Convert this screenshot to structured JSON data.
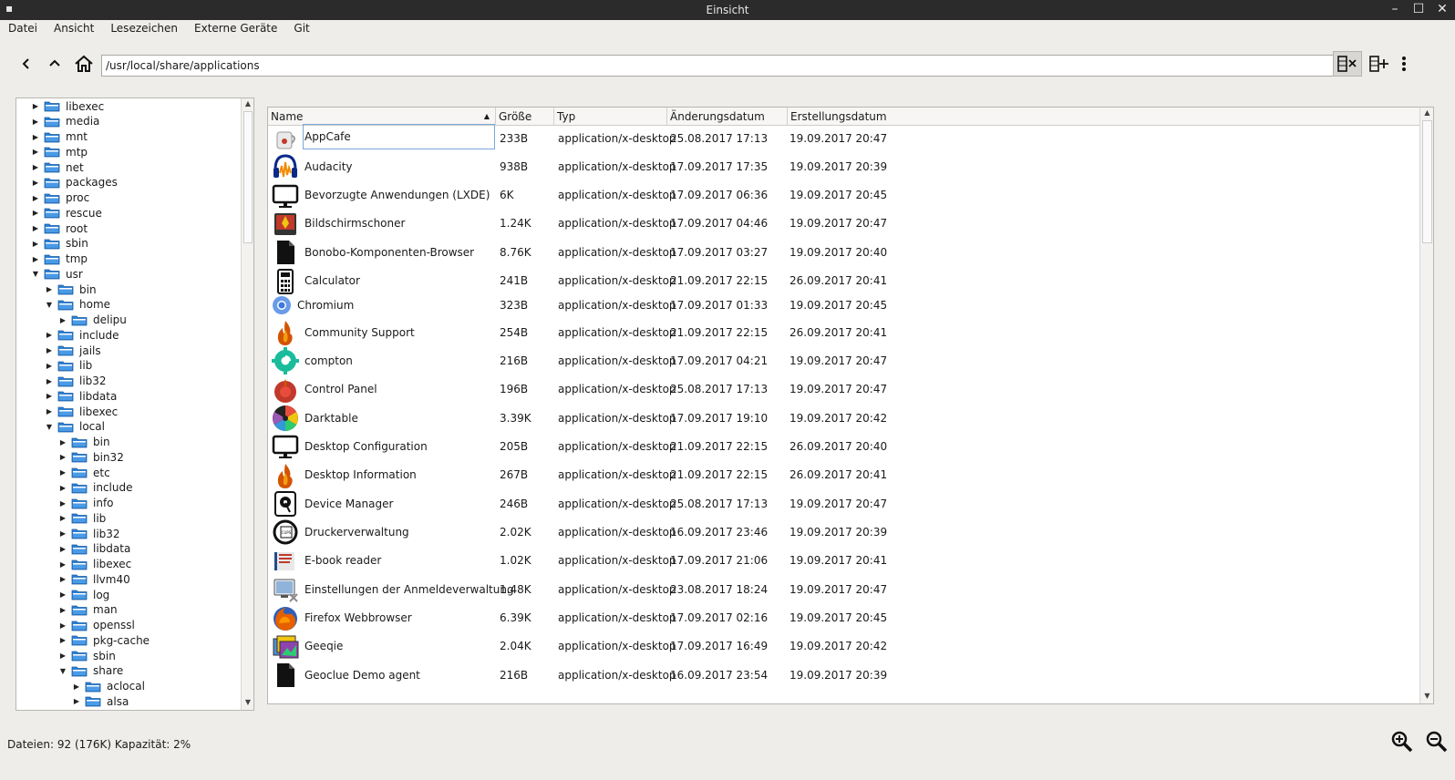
{
  "window": {
    "title": "Einsicht"
  },
  "menu": [
    "Datei",
    "Ansicht",
    "Lesezeichen",
    "Externe Geräte",
    "Git"
  ],
  "toolbar": {
    "path": "/usr/local/share/applications",
    "icons": [
      "back-icon",
      "up-icon",
      "home-icon",
      "close-panel-icon",
      "add-panel-icon",
      "more-options-icon"
    ]
  },
  "tree": [
    {
      "label": "libexec",
      "depth": 0,
      "state": "collapsed"
    },
    {
      "label": "media",
      "depth": 0,
      "state": "collapsed"
    },
    {
      "label": "mnt",
      "depth": 0,
      "state": "collapsed"
    },
    {
      "label": "mtp",
      "depth": 0,
      "state": "collapsed"
    },
    {
      "label": "net",
      "depth": 0,
      "state": "collapsed"
    },
    {
      "label": "packages",
      "depth": 0,
      "state": "collapsed"
    },
    {
      "label": "proc",
      "depth": 0,
      "state": "collapsed"
    },
    {
      "label": "rescue",
      "depth": 0,
      "state": "collapsed"
    },
    {
      "label": "root",
      "depth": 0,
      "state": "collapsed"
    },
    {
      "label": "sbin",
      "depth": 0,
      "state": "collapsed"
    },
    {
      "label": "tmp",
      "depth": 0,
      "state": "collapsed"
    },
    {
      "label": "usr",
      "depth": 0,
      "state": "expanded"
    },
    {
      "label": "bin",
      "depth": 1,
      "state": "collapsed"
    },
    {
      "label": "home",
      "depth": 1,
      "state": "expanded"
    },
    {
      "label": "delipu",
      "depth": 2,
      "state": "collapsed"
    },
    {
      "label": "include",
      "depth": 1,
      "state": "collapsed"
    },
    {
      "label": "jails",
      "depth": 1,
      "state": "collapsed"
    },
    {
      "label": "lib",
      "depth": 1,
      "state": "collapsed"
    },
    {
      "label": "lib32",
      "depth": 1,
      "state": "collapsed"
    },
    {
      "label": "libdata",
      "depth": 1,
      "state": "collapsed"
    },
    {
      "label": "libexec",
      "depth": 1,
      "state": "collapsed"
    },
    {
      "label": "local",
      "depth": 1,
      "state": "expanded"
    },
    {
      "label": "bin",
      "depth": 2,
      "state": "collapsed"
    },
    {
      "label": "bin32",
      "depth": 2,
      "state": "collapsed"
    },
    {
      "label": "etc",
      "depth": 2,
      "state": "collapsed"
    },
    {
      "label": "include",
      "depth": 2,
      "state": "collapsed"
    },
    {
      "label": "info",
      "depth": 2,
      "state": "collapsed"
    },
    {
      "label": "lib",
      "depth": 2,
      "state": "collapsed"
    },
    {
      "label": "lib32",
      "depth": 2,
      "state": "collapsed"
    },
    {
      "label": "libdata",
      "depth": 2,
      "state": "collapsed"
    },
    {
      "label": "libexec",
      "depth": 2,
      "state": "collapsed"
    },
    {
      "label": "llvm40",
      "depth": 2,
      "state": "collapsed"
    },
    {
      "label": "log",
      "depth": 2,
      "state": "collapsed"
    },
    {
      "label": "man",
      "depth": 2,
      "state": "collapsed"
    },
    {
      "label": "openssl",
      "depth": 2,
      "state": "collapsed"
    },
    {
      "label": "pkg-cache",
      "depth": 2,
      "state": "collapsed"
    },
    {
      "label": "sbin",
      "depth": 2,
      "state": "collapsed"
    },
    {
      "label": "share",
      "depth": 2,
      "state": "expanded"
    },
    {
      "label": "aclocal",
      "depth": 3,
      "state": "collapsed"
    },
    {
      "label": "alsa",
      "depth": 3,
      "state": "collapsed"
    }
  ],
  "columns": [
    "Name",
    "Größe",
    "Typ",
    "Änderungsdatum",
    "Erstellungsdatum"
  ],
  "files": [
    {
      "name": "AppCafe",
      "size": "233B",
      "type": "application/x-desktop",
      "modified": "25.08.2017 17:13",
      "created": "19.09.2017 20:47",
      "icon": "appcafe-icon"
    },
    {
      "name": "Audacity",
      "size": "938B",
      "type": "application/x-desktop",
      "modified": "17.09.2017 17:35",
      "created": "19.09.2017 20:39",
      "icon": "audacity-icon"
    },
    {
      "name": "Bevorzugte Anwendungen (LXDE)",
      "size": "6K",
      "type": "application/x-desktop",
      "modified": "17.09.2017 06:36",
      "created": "19.09.2017 20:45",
      "icon": "monitor-icon"
    },
    {
      "name": "Bildschirmschoner",
      "size": "1.24K",
      "type": "application/x-desktop",
      "modified": "17.09.2017 04:46",
      "created": "19.09.2017 20:47",
      "icon": "screensaver-icon"
    },
    {
      "name": "Bonobo-Komponenten-Browser",
      "size": "8.76K",
      "type": "application/x-desktop",
      "modified": "17.09.2017 03:27",
      "created": "19.09.2017 20:40",
      "icon": "document-icon"
    },
    {
      "name": "Calculator",
      "size": "241B",
      "type": "application/x-desktop",
      "modified": "21.09.2017 22:15",
      "created": "26.09.2017 20:41",
      "icon": "calculator-icon"
    },
    {
      "name": "Chromium",
      "size": "323B",
      "type": "application/x-desktop",
      "modified": "17.09.2017 01:33",
      "created": "19.09.2017 20:45",
      "icon": "chromium-icon"
    },
    {
      "name": "Community Support",
      "size": "254B",
      "type": "application/x-desktop",
      "modified": "21.09.2017 22:15",
      "created": "26.09.2017 20:41",
      "icon": "flame-icon"
    },
    {
      "name": "compton",
      "size": "216B",
      "type": "application/x-desktop",
      "modified": "17.09.2017 04:21",
      "created": "19.09.2017 20:47",
      "icon": "compton-icon"
    },
    {
      "name": "Control Panel",
      "size": "196B",
      "type": "application/x-desktop",
      "modified": "25.08.2017 17:13",
      "created": "19.09.2017 20:47",
      "icon": "control-panel-icon"
    },
    {
      "name": "Darktable",
      "size": "3.39K",
      "type": "application/x-desktop",
      "modified": "17.09.2017 19:10",
      "created": "19.09.2017 20:42",
      "icon": "darktable-icon"
    },
    {
      "name": "Desktop Configuration",
      "size": "205B",
      "type": "application/x-desktop",
      "modified": "21.09.2017 22:15",
      "created": "26.09.2017 20:40",
      "icon": "monitor-icon"
    },
    {
      "name": "Desktop Information",
      "size": "267B",
      "type": "application/x-desktop",
      "modified": "21.09.2017 22:15",
      "created": "26.09.2017 20:41",
      "icon": "flame-icon"
    },
    {
      "name": "Device Manager",
      "size": "246B",
      "type": "application/x-desktop",
      "modified": "25.08.2017 17:13",
      "created": "19.09.2017 20:47",
      "icon": "device-manager-icon"
    },
    {
      "name": "Druckerverwaltung",
      "size": "2.02K",
      "type": "application/x-desktop",
      "modified": "16.09.2017 23:46",
      "created": "19.09.2017 20:39",
      "icon": "printer-icon"
    },
    {
      "name": "E-book reader",
      "size": "1.02K",
      "type": "application/x-desktop",
      "modified": "17.09.2017 21:06",
      "created": "19.09.2017 20:41",
      "icon": "ebook-icon"
    },
    {
      "name": "Einstellungen der Anmeldeverwaltung",
      "size": "1.48K",
      "type": "application/x-desktop",
      "modified": "23.08.2017 18:24",
      "created": "19.09.2017 20:47",
      "icon": "login-settings-icon"
    },
    {
      "name": "Firefox Webbrowser",
      "size": "6.39K",
      "type": "application/x-desktop",
      "modified": "17.09.2017 02:16",
      "created": "19.09.2017 20:45",
      "icon": "firefox-icon"
    },
    {
      "name": "Geeqie",
      "size": "2.04K",
      "type": "application/x-desktop",
      "modified": "17.09.2017 16:49",
      "created": "19.09.2017 20:42",
      "icon": "geeqie-icon"
    },
    {
      "name": "Geoclue Demo agent",
      "size": "216B",
      "type": "application/x-desktop",
      "modified": "16.09.2017 23:54",
      "created": "19.09.2017 20:39",
      "icon": "document-icon"
    }
  ],
  "status": "Dateien: 92 (176K) Kapazität: 2%",
  "colors": {
    "titlebar": "#2b2b2b",
    "window_bg": "#efedea",
    "folder": "#2b7fd4",
    "selection_border": "#7aa7d9"
  }
}
